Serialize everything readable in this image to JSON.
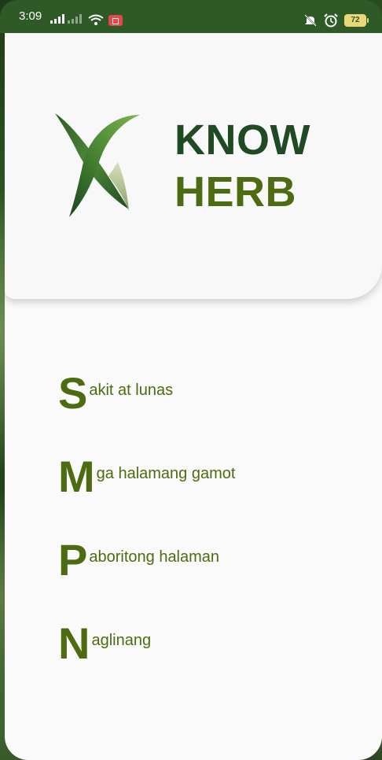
{
  "status_bar": {
    "time": "3:09",
    "battery": "72",
    "icons": [
      "signal-icon",
      "signal-x-icon",
      "wifi-icon",
      "screen-record-icon",
      "mute-icon",
      "alarm-icon",
      "battery-icon"
    ]
  },
  "brand": {
    "line1": "KNOW",
    "line2": "HERB",
    "colors": {
      "dark_green": "#1f4a23",
      "olive": "#4d6b10"
    }
  },
  "menu": {
    "items": [
      {
        "initial": "S",
        "rest": "akit at lunas"
      },
      {
        "initial": "M",
        "rest": "ga halamang gamot"
      },
      {
        "initial": "P",
        "rest": "aboritong halaman"
      },
      {
        "initial": "N",
        "rest": "aglinang"
      }
    ]
  }
}
